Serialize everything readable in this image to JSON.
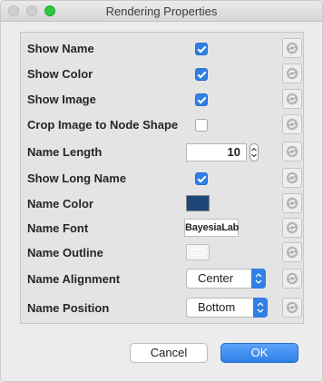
{
  "window": {
    "title": "Rendering Properties"
  },
  "rows": [
    {
      "label": "Show Name",
      "checked": true
    },
    {
      "label": "Show Color",
      "checked": true
    },
    {
      "label": "Show Image",
      "checked": true
    },
    {
      "label": "Crop Image to Node Shape",
      "checked": false
    },
    {
      "label": "Name Length",
      "value": "10"
    },
    {
      "label": "Show Long Name",
      "checked": true
    },
    {
      "label": "Name Color",
      "color": "#1e4677"
    },
    {
      "label": "Name Font",
      "font_preview": "BayesiaLab"
    },
    {
      "label": "Name Outline",
      "color": "#f4f4f4"
    },
    {
      "label": "Name Alignment",
      "selected": "Center"
    },
    {
      "label": "Name Position",
      "selected": "Bottom"
    }
  ],
  "buttons": {
    "cancel": "Cancel",
    "ok": "OK"
  },
  "colors": {
    "accent": "#2f7fe6",
    "panel": "#e4e4e4"
  },
  "icons": {
    "reset": "reset-default-icon",
    "stepper": "chevron-updown-icon",
    "select": "chevron-updown-icon"
  }
}
